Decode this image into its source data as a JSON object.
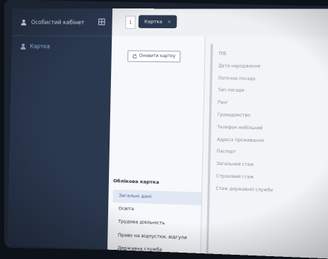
{
  "sidebar": {
    "header_label": "Особистий кабінет",
    "items": [
      {
        "label": "Картка"
      }
    ]
  },
  "topbar": {
    "page_number": "1",
    "tab_label": "Картка",
    "tab_close": "×"
  },
  "card": {
    "refresh_label": "Оновити картку",
    "section_title": "Облікова картка",
    "menu": [
      {
        "label": "Загальні дані",
        "active": true
      },
      {
        "label": "Освіта"
      },
      {
        "label": "Трудова діяльність"
      },
      {
        "label": "Право на відпустки, відгули"
      },
      {
        "label": "Державна служба"
      }
    ]
  },
  "fields": [
    "ПІБ",
    "Дата народження",
    "Поточна посада",
    "Тип посади",
    "Ранг",
    "Громадянство",
    "Телефон мобільний",
    "Адреса проживання",
    "Паспорт",
    "Загальний стаж",
    "Страховий стаж",
    "Стаж державної служби"
  ]
}
